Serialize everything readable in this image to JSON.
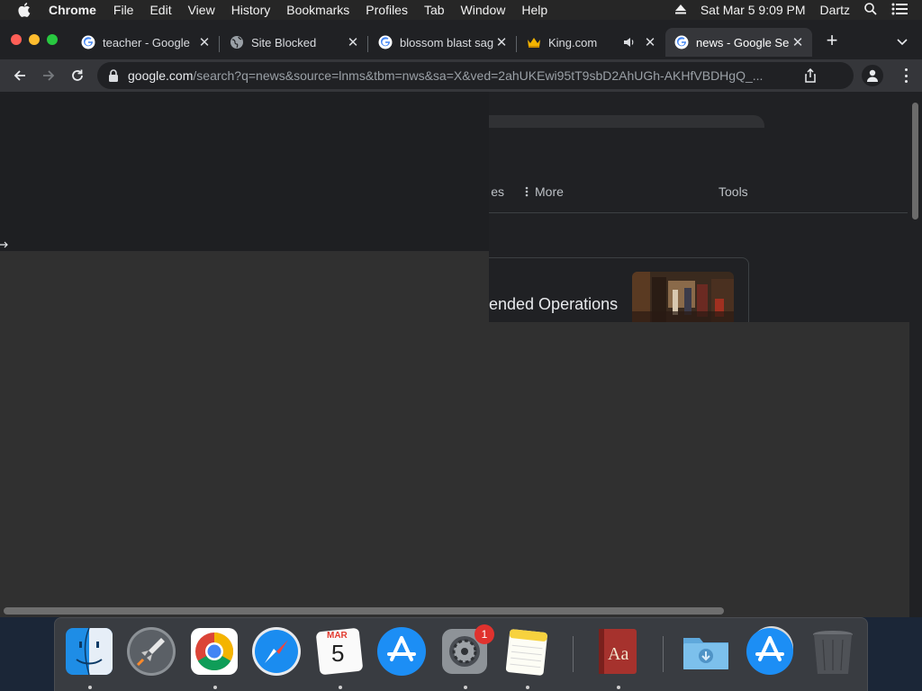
{
  "menubar": {
    "app_name": "Chrome",
    "menus": [
      "File",
      "Edit",
      "View",
      "History",
      "Bookmarks",
      "Profiles",
      "Tab",
      "Window",
      "Help"
    ],
    "clock": "Sat Mar 5  9:09 PM",
    "user": "Dartz"
  },
  "tabs": [
    {
      "title": "teacher - Google",
      "icon": "google-icon",
      "active": false
    },
    {
      "title": "Site Blocked",
      "icon": "globe-icon",
      "active": false
    },
    {
      "title": "blossom blast sag",
      "icon": "google-icon",
      "active": false
    },
    {
      "title": "King.com",
      "icon": "king-crown-icon",
      "audio": true,
      "active": false
    },
    {
      "title": "news - Google Se",
      "icon": "google-icon",
      "active": true
    }
  ],
  "omnibox": {
    "host": "google.com",
    "path": "/search?q=news&source=lnms&tbm=nws&sa=X&ved=2ahUKEwi95tT9sbD2AhUGh-AKHfVBDHgQ_..."
  },
  "page": {
    "tab_fragment": "es",
    "more_label": "More",
    "tools_label": "Tools",
    "card_title": "ended Operations"
  },
  "dock": {
    "items": [
      "finder-icon",
      "launchpad-icon",
      "chrome-icon",
      "safari-icon",
      "calendar-icon",
      "app-store-icon",
      "system-preferences-icon",
      "notes-icon",
      "dictionary-icon",
      "downloads-folder-icon",
      "app-store-icon",
      "trash-icon"
    ],
    "calendar_month": "MAR",
    "calendar_day": "5",
    "system_preferences_badge": "1"
  },
  "colors": {
    "background": "#202124",
    "accent_blue": "#8ab4f8",
    "badge_red": "#e0322e"
  }
}
